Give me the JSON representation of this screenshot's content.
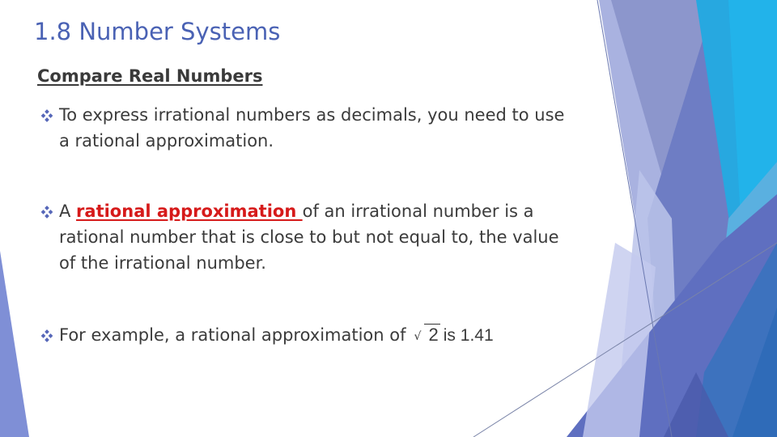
{
  "slide": {
    "title": "1.8 Number Systems",
    "subtitle": "Compare Real Numbers",
    "bullet_icon": "diamond-cluster-icon",
    "accent_color": "#4a62b4",
    "highlight_color": "#d61a1a",
    "bullets": [
      {
        "lines": [
          "To express irrational numbers as decimals, you need to use",
          "a rational approximation."
        ]
      },
      {
        "prefix": "A ",
        "term": "rational approximation ",
        "rest_line1": "of an irrational number is a",
        "lines": [
          "rational number that is close to but not equal to, the value",
          "of the irrational number."
        ]
      },
      {
        "before": "For example, a rational approximation of",
        "radical_symbol": "√",
        "radicand": "2",
        "after": "is 1.41"
      }
    ]
  }
}
